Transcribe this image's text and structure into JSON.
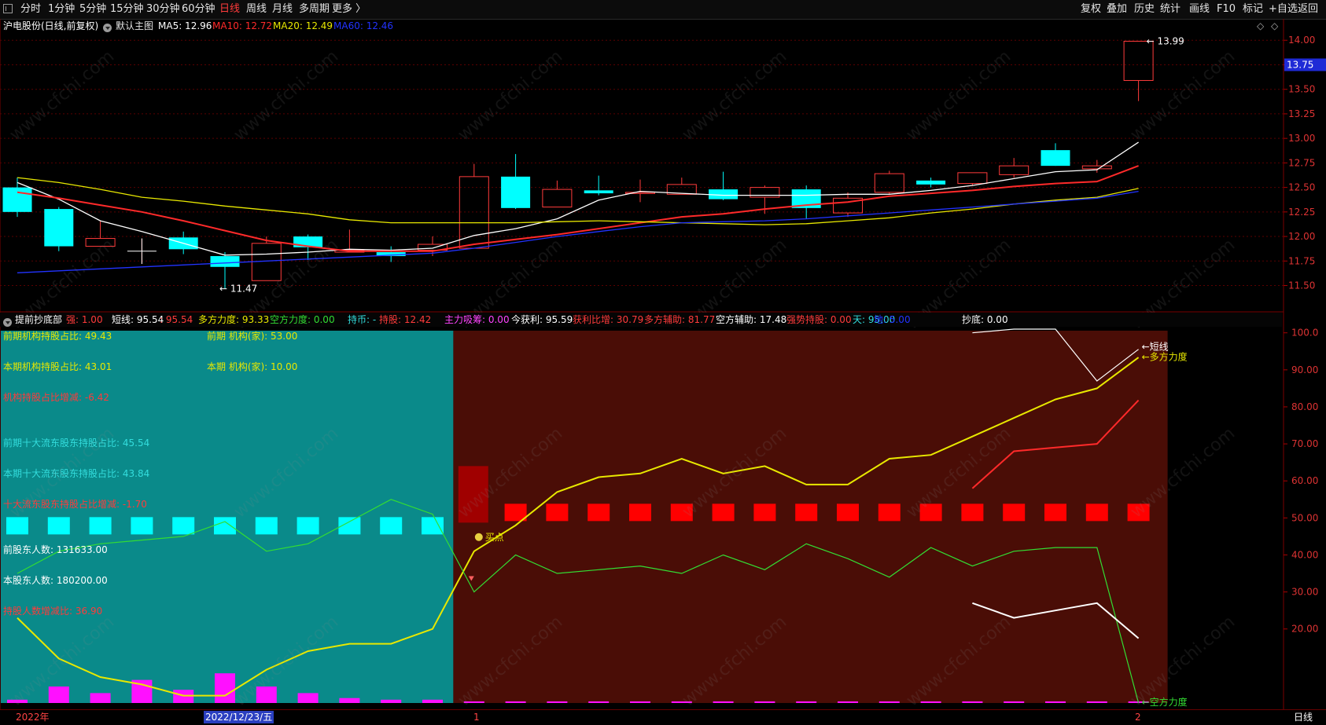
{
  "toolbar": {
    "left_items": [
      "分时",
      "1分钟",
      "5分钟",
      "15分钟",
      "30分钟",
      "60分钟",
      "日线",
      "周线",
      "月线",
      "多周期",
      "更多 〉"
    ],
    "active_left": "日线",
    "right_items": [
      "复权",
      "叠加",
      "历史",
      "统计",
      "画线",
      "F10",
      "标记",
      "+自选",
      "返回"
    ]
  },
  "main_chart": {
    "stock_title": "沪电股份(日线,前复权)",
    "theme_label": "默认主图",
    "ma5": {
      "label": "MA5: 12.96",
      "color": "#ffffff"
    },
    "ma10": {
      "label": "MA10: 12.72",
      "color": "#ff2a2a"
    },
    "ma20": {
      "label": "MA20: 12.49",
      "color": "#e8e800"
    },
    "ma60": {
      "label": "MA60: 12.46",
      "color": "#2233ff"
    },
    "price_ticks": [
      "14.00",
      "13.75",
      "13.50",
      "13.25",
      "13.00",
      "12.75",
      "12.50",
      "12.25",
      "12.00",
      "11.75",
      "11.50"
    ],
    "current_price": "13.75",
    "high_label": "13.99",
    "low_label": "11.47",
    "diamond_icons": [
      "◇",
      "◇"
    ]
  },
  "indicator": {
    "name": "提前抄底部",
    "fields": [
      {
        "text": "强: 1.00",
        "color": "#ff3b3b"
      },
      {
        "text": "短线: 95.54",
        "color": "#ffffff"
      },
      {
        "text": ": 95.54",
        "color": "#ff3b3b"
      },
      {
        "text": "多方力度: 93.33",
        "color": "#e8e800"
      },
      {
        "text": "空方力度: 0.00",
        "color": "#33dd33"
      },
      {
        "text": "持币: -",
        "color": "#33dddd"
      },
      {
        "text": "持股: 12.42",
        "color": "#ff3b3b"
      },
      {
        "text": "主力吸筹: 0.00",
        "color": "#ff44ff"
      },
      {
        "text": "今获利: 95.59",
        "color": "#ffffff"
      },
      {
        "text": "获利比增: 30.79",
        "color": "#ff3b3b"
      },
      {
        "text": "多方辅助: 81.77",
        "color": "#ff3b3b"
      },
      {
        "text": "空方辅助: 17.48",
        "color": "#ffffff"
      },
      {
        "text": "强势持股: 0.00",
        "color": "#ff3b3b"
      },
      {
        "text": "天: 95.00",
        "color": "#33dddd"
      },
      {
        "text": "地: 5.00",
        "color": "#2233ff"
      },
      {
        "text": "抄底: 0.00",
        "color": "#ffffff"
      }
    ],
    "ticks": [
      "100.0",
      "90.00",
      "80.00",
      "70.00",
      "60.00",
      "50.00",
      "40.00",
      "30.00",
      "20.00"
    ],
    "overlay_texts": [
      {
        "text": "前期机构持股占比: 49.43",
        "color": "#e8e800"
      },
      {
        "text": "前期 机构(家): 53.00",
        "color": "#e8e800"
      },
      {
        "text": "本期机构持股占比: 43.01",
        "color": "#e8e800"
      },
      {
        "text": "本期 机构(家): 10.00",
        "color": "#e8e800"
      },
      {
        "text": "机构持股占比增减: -6.42",
        "color": "#ff3b3b"
      },
      {
        "text": "前期十大流东股东持股占比: 45.54",
        "color": "#33dddd"
      },
      {
        "text": "本期十大流东股东持股占比: 43.84",
        "color": "#33dddd"
      },
      {
        "text": "十大流东股东持股占比增减: -1.70",
        "color": "#ff3b3b"
      },
      {
        "text": "前股东人数: 131633.00",
        "color": "#ffffff"
      },
      {
        "text": "本股东人数: 180200.00",
        "color": "#ffffff"
      },
      {
        "text": "持股人数增减比: 36.90",
        "color": "#ff3b3b"
      }
    ],
    "buy_point_label": "买点",
    "line_labels": [
      {
        "text": "短线",
        "color": "#ffffff"
      },
      {
        "text": "多方力度",
        "color": "#e8e800"
      },
      {
        "text": "空方力度",
        "color": "#33dd33"
      }
    ],
    "colors": {
      "cyan_zone": "#0a8a8a",
      "red_zone": "#4a0d06",
      "block_cyan": "#00ffff",
      "block_red": "#ff0000"
    }
  },
  "bottom": {
    "year_label": "2022年",
    "date_label": "2022/12/23/五",
    "marker_1": "1",
    "marker_2": "2",
    "period_label": "日线"
  },
  "chart_data": [
    {
      "type": "candlestick",
      "title": "沪电股份(日线,前复权)",
      "ylim": [
        11.4,
        14.05
      ],
      "candles": [
        {
          "o": 12.5,
          "c": 12.25,
          "h": 12.6,
          "l": 12.2,
          "up": false
        },
        {
          "o": 12.28,
          "c": 11.9,
          "h": 12.3,
          "l": 11.85,
          "up": false
        },
        {
          "o": 11.9,
          "c": 11.98,
          "h": 12.16,
          "l": 11.9,
          "up": true
        },
        {
          "o": 11.85,
          "c": 11.85,
          "h": 11.98,
          "l": 11.72,
          "up": true
        },
        {
          "o": 11.99,
          "c": 11.87,
          "h": 12.05,
          "l": 11.82,
          "up": false
        },
        {
          "o": 11.8,
          "c": 11.69,
          "h": 11.84,
          "l": 11.47,
          "up": false
        },
        {
          "o": 11.55,
          "c": 11.93,
          "h": 12.0,
          "l": 11.55,
          "up": true
        },
        {
          "o": 12.0,
          "c": 11.89,
          "h": 12.02,
          "l": 11.76,
          "up": false
        },
        {
          "o": 11.84,
          "c": 11.86,
          "h": 12.07,
          "l": 11.84,
          "up": true
        },
        {
          "o": 11.84,
          "c": 11.8,
          "h": 11.9,
          "l": 11.74,
          "up": false
        },
        {
          "o": 11.86,
          "c": 11.92,
          "h": 12.0,
          "l": 11.8,
          "up": true
        },
        {
          "o": 11.88,
          "c": 12.61,
          "h": 12.74,
          "l": 11.88,
          "up": true
        },
        {
          "o": 12.61,
          "c": 12.29,
          "h": 12.84,
          "l": 12.28,
          "up": false
        },
        {
          "o": 12.3,
          "c": 12.48,
          "h": 12.57,
          "l": 12.3,
          "up": true
        },
        {
          "o": 12.47,
          "c": 12.44,
          "h": 12.62,
          "l": 12.42,
          "up": false
        },
        {
          "o": 12.44,
          "c": 12.45,
          "h": 12.58,
          "l": 12.35,
          "up": true
        },
        {
          "o": 12.43,
          "c": 12.53,
          "h": 12.6,
          "l": 12.43,
          "up": true
        },
        {
          "o": 12.48,
          "c": 12.38,
          "h": 12.66,
          "l": 12.37,
          "up": false
        },
        {
          "o": 12.4,
          "c": 12.5,
          "h": 12.52,
          "l": 12.23,
          "up": true
        },
        {
          "o": 12.48,
          "c": 12.29,
          "h": 12.52,
          "l": 12.18,
          "up": false
        },
        {
          "o": 12.24,
          "c": 12.39,
          "h": 12.45,
          "l": 12.2,
          "up": true
        },
        {
          "o": 12.45,
          "c": 12.64,
          "h": 12.67,
          "l": 12.43,
          "up": true
        },
        {
          "o": 12.57,
          "c": 12.53,
          "h": 12.6,
          "l": 12.5,
          "up": false
        },
        {
          "o": 12.54,
          "c": 12.65,
          "h": 12.65,
          "l": 12.52,
          "up": true
        },
        {
          "o": 12.63,
          "c": 12.72,
          "h": 12.8,
          "l": 12.6,
          "up": true
        },
        {
          "o": 12.88,
          "c": 12.72,
          "h": 12.95,
          "l": 12.72,
          "up": false
        },
        {
          "o": 12.69,
          "c": 12.72,
          "h": 12.78,
          "l": 12.65,
          "up": true
        },
        {
          "o": 13.59,
          "c": 13.99,
          "h": 13.99,
          "l": 13.38,
          "up": true
        }
      ],
      "series": [
        {
          "name": "MA5",
          "color": "#ffffff",
          "values": [
            12.55,
            12.38,
            12.16,
            12.05,
            11.93,
            11.81,
            11.82,
            11.84,
            11.87,
            11.86,
            11.88,
            12.01,
            12.08,
            12.18,
            12.37,
            12.46,
            12.44,
            12.42,
            12.42,
            12.42,
            12.43,
            12.43,
            12.47,
            12.52,
            12.59,
            12.66,
            12.68,
            12.96
          ]
        },
        {
          "name": "MA10",
          "color": "#ff2a2a",
          "values": [
            12.45,
            12.39,
            12.32,
            12.25,
            12.16,
            12.06,
            11.96,
            11.9,
            11.85,
            11.85,
            11.85,
            11.92,
            11.97,
            12.02,
            12.08,
            12.14,
            12.2,
            12.23,
            12.28,
            12.32,
            12.35,
            12.41,
            12.44,
            12.47,
            12.51,
            12.54,
            12.56,
            12.72
          ]
        },
        {
          "name": "MA20",
          "color": "#e8e800",
          "values": [
            12.6,
            12.55,
            12.48,
            12.4,
            12.36,
            12.31,
            12.27,
            12.23,
            12.17,
            12.14,
            12.14,
            12.14,
            12.14,
            12.15,
            12.16,
            12.15,
            12.14,
            12.13,
            12.12,
            12.13,
            12.16,
            12.19,
            12.24,
            12.28,
            12.33,
            12.37,
            12.4,
            12.49
          ]
        },
        {
          "name": "MA60",
          "color": "#2233ff",
          "values": [
            11.63,
            11.65,
            11.67,
            11.69,
            11.71,
            11.73,
            11.75,
            11.77,
            11.79,
            11.81,
            11.83,
            11.88,
            11.94,
            12.0,
            12.05,
            12.1,
            12.14,
            12.15,
            12.16,
            12.18,
            12.21,
            12.24,
            12.27,
            12.3,
            12.33,
            12.36,
            12.39,
            12.46
          ]
        }
      ]
    },
    {
      "type": "line",
      "title": "提前抄底部",
      "ylim": [
        0,
        101
      ],
      "series": [
        {
          "name": "多方力度",
          "color": "#e8e800",
          "values": [
            23,
            12,
            7,
            5,
            2,
            2,
            9,
            14,
            16,
            16,
            20,
            41,
            48,
            57,
            61,
            62,
            66,
            62,
            64,
            59,
            59,
            66,
            67,
            72,
            77,
            82,
            85,
            93.33
          ]
        },
        {
          "name": "空方力度",
          "color": "#33dd33",
          "values": [
            35,
            41,
            43,
            44,
            45,
            49,
            41,
            43,
            49,
            55,
            51,
            30,
            40,
            35,
            36,
            37,
            35,
            40,
            36,
            43,
            39,
            34,
            42,
            37,
            41,
            42,
            42,
            0
          ]
        },
        {
          "name": "多方辅助",
          "color": "#ff2a2a",
          "values": [
            null,
            null,
            null,
            null,
            null,
            null,
            null,
            null,
            null,
            null,
            null,
            null,
            null,
            null,
            null,
            null,
            null,
            null,
            null,
            null,
            null,
            null,
            null,
            58,
            68,
            69,
            70,
            81.77
          ]
        },
        {
          "name": "空方辅助",
          "color": "#ffffff",
          "values": [
            null,
            null,
            null,
            null,
            null,
            null,
            null,
            null,
            null,
            null,
            null,
            null,
            null,
            null,
            null,
            null,
            null,
            null,
            null,
            null,
            null,
            null,
            null,
            27,
            23,
            25,
            27,
            17.48
          ]
        },
        {
          "name": "短线",
          "color": "#ffffff",
          "values": [
            null,
            null,
            null,
            null,
            null,
            null,
            null,
            null,
            null,
            null,
            null,
            null,
            null,
            null,
            null,
            null,
            null,
            null,
            null,
            null,
            null,
            null,
            null,
            100,
            101,
            101,
            87,
            95.54
          ]
        }
      ],
      "bars": [
        1,
        5,
        3,
        7,
        4,
        9,
        5,
        3,
        1.5,
        1,
        1,
        0.5,
        0.5,
        0.5,
        0.5,
        0.5,
        0.5,
        0.5,
        0.5,
        0.5,
        0.5,
        0.5,
        0.5,
        0.5,
        0.5,
        0.5,
        0.5,
        0.5
      ],
      "block_level": 50
    }
  ]
}
